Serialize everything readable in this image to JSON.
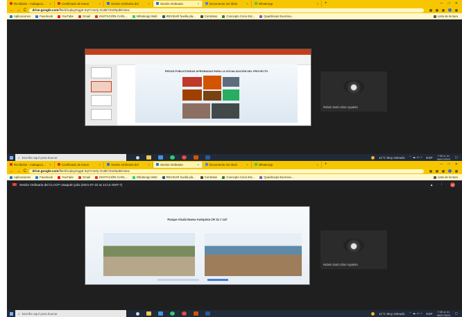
{
  "browser": {
    "tabs": [
      {
        "label": "Recibidos - malagac1...",
        "close": "×"
      },
      {
        "label": "Certificado de trasor",
        "close": "×"
      },
      {
        "label": "Sesión Ordinaria del",
        "close": "×"
      },
      {
        "label": "Sesión Ordinaria",
        "close": "×"
      },
      {
        "label": "Documento sin título",
        "close": "×"
      },
      {
        "label": "WhatsApp",
        "close": "×"
      }
    ],
    "new_tab": "+",
    "window_controls": [
      "—",
      "□",
      "✕"
    ],
    "nav": {
      "back": "←",
      "forward": "→",
      "reload": "C"
    },
    "url_host": "drive.google.com",
    "url_path_top": "/file/d/1qkay/sgg5-3qrYHorty-GvdE7Zx0hpdE/view",
    "url_path_bottom": "/file/d/1qkay/sgg5-3qrYHorty-GvdE7Zx0hpdE/view",
    "bookmarks": [
      "Aplicaciones",
      "Facebook",
      "YouTube",
      "Gmail",
      "INVITACIÓN-CARL...",
      "WhatsApp Web",
      "REVISAR huella pla...",
      "Contratos",
      "Concepto Cono Est...",
      "Quadriceps Exercise..."
    ],
    "bookmarks_right": "Lista de lectura"
  },
  "meet": {
    "title": "Sesión Ordinaria del CLACP Usaquén julio (2021-07-22 at 14:13 GMT-7)",
    "participant_top": "Rubén Darío Díaz Agudelo",
    "participant_bottom": "Rubén Darío Díaz Agudelo",
    "avatar_letter": "M"
  },
  "slides": {
    "top_title": "PIEZAS PUBLICITARIAS APROBADAS PARA LA SOCIALIZACIÓN DEL PROYECTO",
    "bottom_title": "Parque Alcalá Nueva Autopista CR 21 # 147"
  },
  "taskbar": {
    "search_placeholder": "Escribe aquí para buscar",
    "weather": "11°C Muy soleado",
    "lang": "ESP",
    "time": "7:40 a. m.",
    "date": "26/07/2021"
  },
  "colors": {
    "chrome_yellow": "#f6c700",
    "taskbar": "#202a38",
    "ppt_red": "#c43e1c",
    "meet_bg": "#1f1f1f"
  }
}
